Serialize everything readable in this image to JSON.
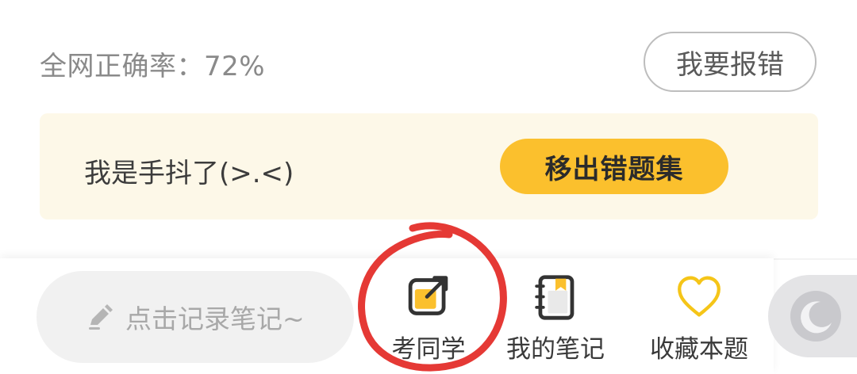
{
  "header": {
    "accuracy_text": "全网正确率：72%",
    "report_label": "我要报错"
  },
  "note_card": {
    "note_text": "我是手抖了(>.<)",
    "remove_label": "移出错题集"
  },
  "bottom_bar": {
    "note_placeholder": "点击记录笔记~",
    "tools": {
      "exam": "考同学",
      "notes": "我的笔记",
      "favorite": "收藏本题"
    }
  },
  "icons": {
    "pencil": "pencil-icon",
    "exam": "share-external-icon",
    "notes": "notebook-icon",
    "favorite": "heart-icon",
    "night_mode": "moon-icon"
  },
  "colors": {
    "accent_yellow": "#fbc02d",
    "card_bg": "#fdf8e8",
    "annotation_red": "#e53935"
  }
}
